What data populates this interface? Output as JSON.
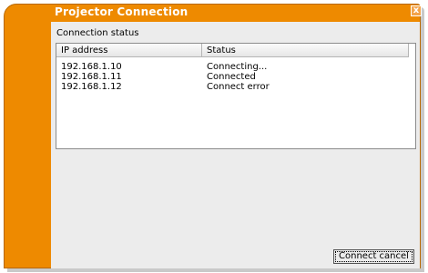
{
  "window": {
    "title": "Projector Connection",
    "close_glyph": "x",
    "accent_color": "#ee8a00"
  },
  "status_section": {
    "label": "Connection status",
    "columns": [
      "IP address",
      "Status"
    ],
    "rows": [
      {
        "ip": "192.168.1.10",
        "status": "Connecting..."
      },
      {
        "ip": "192.168.1.11",
        "status": "Connected"
      },
      {
        "ip": "192.168.1.12",
        "status": "Connect error"
      }
    ]
  },
  "buttons": {
    "cancel_label": "Connect cancel"
  }
}
